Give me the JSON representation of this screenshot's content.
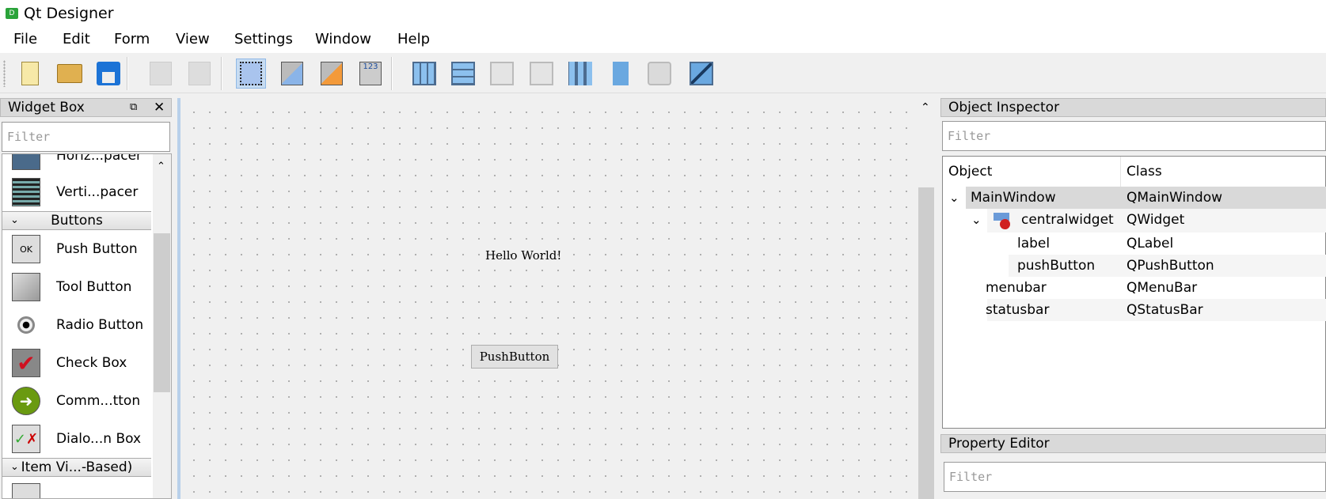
{
  "app": {
    "title": "Qt Designer",
    "icon": "D"
  },
  "menu": [
    "File",
    "Edit",
    "Form",
    "View",
    "Settings",
    "Window",
    "Help"
  ],
  "toolbar": {
    "icons": [
      "new-form-icon",
      "open-form-icon",
      "save-form-icon",
      "bring-to-front-icon",
      "send-to-back-icon",
      "edit-widgets-icon",
      "edit-signals-slots-icon",
      "edit-buddies-icon",
      "edit-tab-order-icon",
      "lay-out-horizontally-icon",
      "lay-out-vertically-icon",
      "horizontal-splitter-icon",
      "vertical-splitter-icon",
      "lay-out-grid-icon",
      "form-layout-icon",
      "break-layout-icon",
      "adjust-size-icon"
    ],
    "active": "edit-widgets-icon"
  },
  "widget_box": {
    "title": "Widget Box",
    "filter_placeholder": "Filter",
    "items": [
      {
        "label": "Horiz...pacer"
      },
      {
        "label": "Verti...pacer"
      },
      {
        "category": "Buttons"
      },
      {
        "label": "Push Button",
        "icon": "OK"
      },
      {
        "label": "Tool Button"
      },
      {
        "label": "Radio Button"
      },
      {
        "label": "Check Box"
      },
      {
        "label": "Comm...tton"
      },
      {
        "label": "Dialo...n Box"
      },
      {
        "category": "Item Vi...-Based)"
      }
    ]
  },
  "form": {
    "label_text": "Hello World!",
    "button_text": "PushButton"
  },
  "object_inspector": {
    "title": "Object Inspector",
    "filter_placeholder": "Filter",
    "columns": [
      "Object",
      "Class"
    ],
    "rows": [
      {
        "object": "MainWindow",
        "class": "QMainWindow",
        "selected": true
      },
      {
        "object": "centralwidget",
        "class": "QWidget"
      },
      {
        "object": "label",
        "class": "QLabel"
      },
      {
        "object": "pushButton",
        "class": "QPushButton"
      },
      {
        "object": "menubar",
        "class": "QMenuBar"
      },
      {
        "object": "statusbar",
        "class": "QStatusBar"
      }
    ]
  },
  "property_editor": {
    "title": "Property Editor",
    "filter_placeholder": "Filter"
  },
  "colors": {
    "selection": "#d9d9d9",
    "active_tool": "#c7dcf2"
  }
}
